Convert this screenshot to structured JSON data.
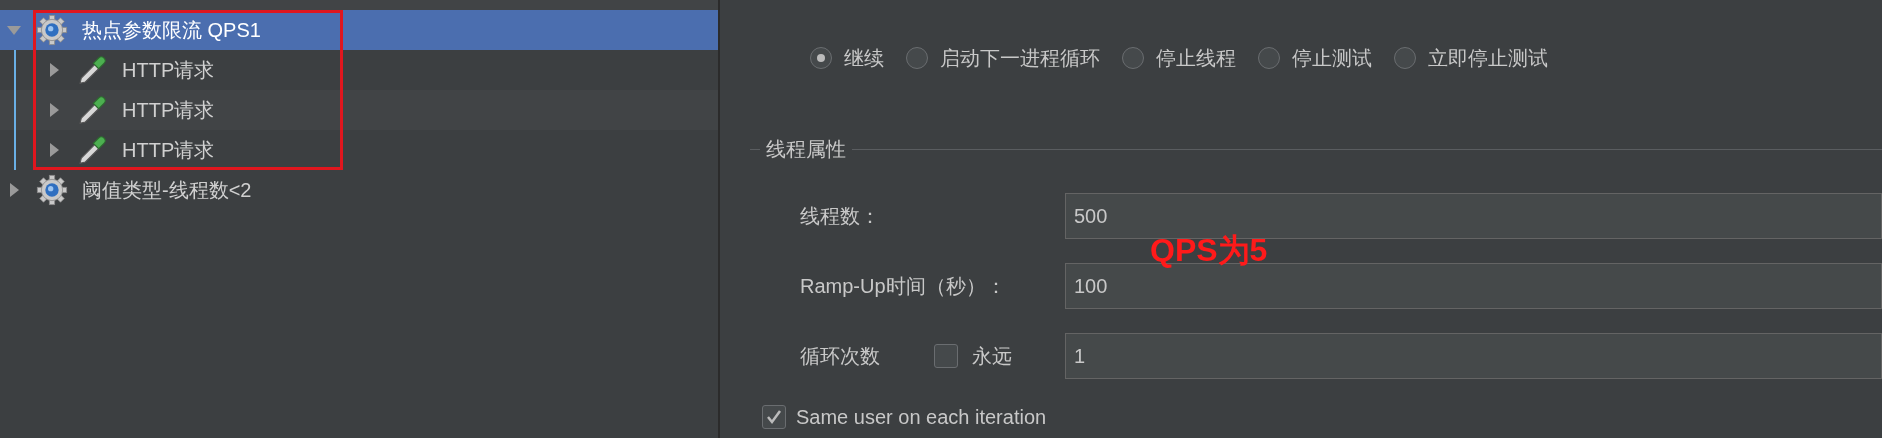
{
  "tree": [
    {
      "label": "热点参数限流 QPS1",
      "kind": "thread-group",
      "expanded": true,
      "selected": true,
      "highlighted": true,
      "children": [
        {
          "label": "HTTP请求",
          "kind": "sampler",
          "expanded": false,
          "selected": false
        },
        {
          "label": "HTTP请求",
          "kind": "sampler",
          "expanded": false,
          "selected": false
        },
        {
          "label": "HTTP请求",
          "kind": "sampler",
          "expanded": false,
          "selected": false
        }
      ]
    },
    {
      "label": "阈值类型-线程数<2",
      "kind": "thread-group",
      "expanded": false,
      "selected": false,
      "highlighted": false
    }
  ],
  "error_action": {
    "options": [
      {
        "label": "继续",
        "selected": true
      },
      {
        "label": "启动下一进程循环",
        "selected": false
      },
      {
        "label": "停止线程",
        "selected": false
      },
      {
        "label": "停止测试",
        "selected": false
      },
      {
        "label": "立即停止测试",
        "selected": false
      }
    ]
  },
  "thread_properties": {
    "title": "线程属性",
    "fields": [
      {
        "label": "线程数：",
        "value": "500"
      },
      {
        "label": "Ramp-Up时间（秒）：",
        "value": "100"
      },
      {
        "label": "循环次数",
        "value": "1",
        "forever": {
          "label": "永远",
          "checked": false
        }
      }
    ],
    "same_user": {
      "label": "Same user on each iteration",
      "checked": true
    }
  },
  "note": "QPS为5"
}
